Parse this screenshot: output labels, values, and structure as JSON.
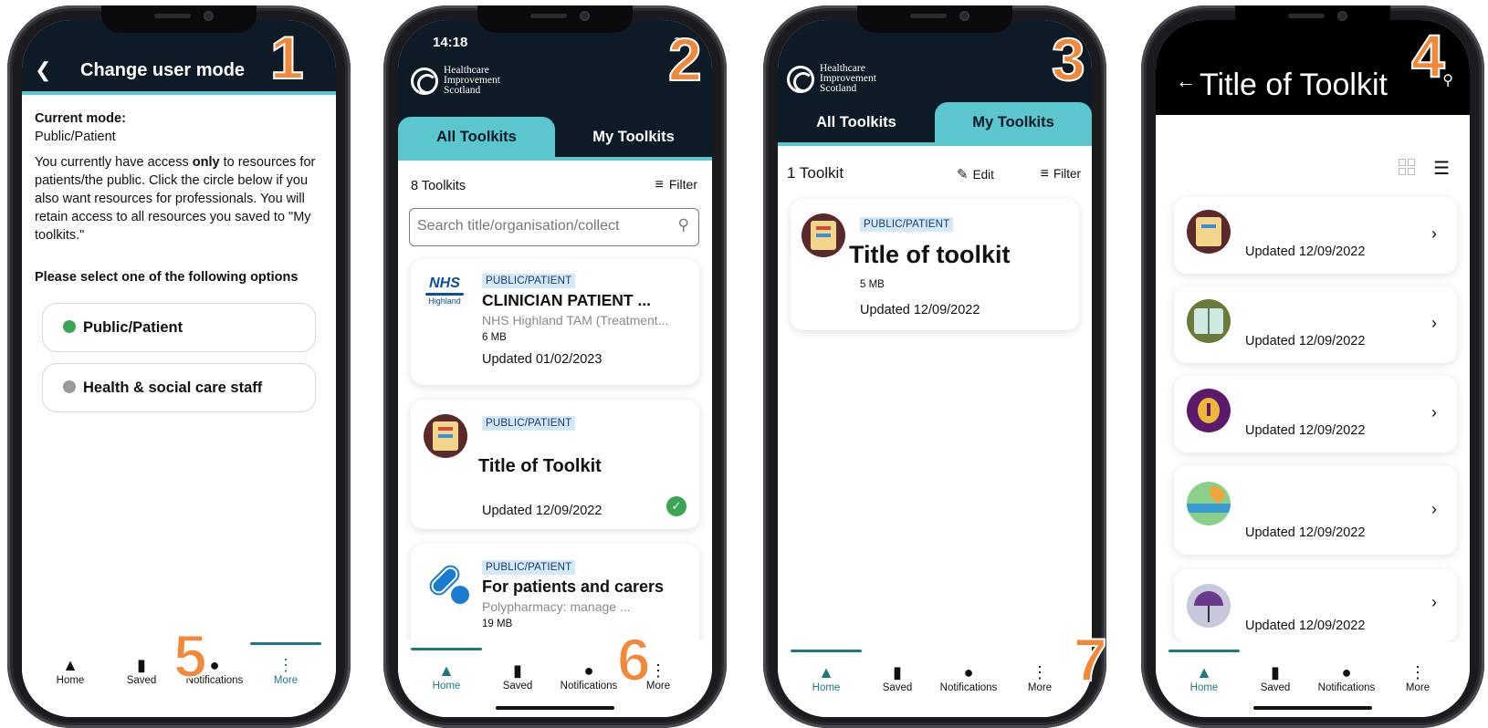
{
  "numbers": [
    "1",
    "2",
    "3",
    "4",
    "5",
    "6",
    "7"
  ],
  "nav": {
    "home": "Home",
    "saved": "Saved",
    "notifications": "Notifications",
    "more": "More"
  },
  "logo": {
    "line1": "Healthcare",
    "line2": "Improvement",
    "line3": "Scotland"
  },
  "tabs": {
    "all": "All Toolkits",
    "mine": "My Toolkits"
  },
  "screen1": {
    "title": "Change user mode",
    "current_label": "Current mode:",
    "current_value": "Public/Patient",
    "desc_a": "You currently have access ",
    "desc_b": "only",
    "desc_c": " to resources for patients/the public. Click the circle below if you also want resources for professionals. You will retain access to all resources you saved to \"My toolkits.\"",
    "prompt": "Please select one of the following options",
    "option1": "Public/Patient",
    "option2": "Health & social care staff"
  },
  "screen2": {
    "time": "14:18",
    "count": "8 Toolkits",
    "filter": "Filter",
    "search_placeholder": "Search title/organisation/collect",
    "cards": [
      {
        "badge": "PUBLIC/PATIENT",
        "title": "CLINICIAN PATIENT ...",
        "org": "NHS Highland TAM (Treatment...",
        "size": "6 MB",
        "updated": "Updated 01/02/2023",
        "logo_a": "NHS",
        "logo_b": "Highland"
      },
      {
        "badge": "PUBLIC/PATIENT",
        "title": "Title of Toolkit",
        "updated": "Updated 12/09/2022"
      },
      {
        "badge": "PUBLIC/PATIENT",
        "title": "For patients and carers",
        "org": "Polypharmacy: manage ...",
        "size": "19 MB"
      }
    ]
  },
  "screen3": {
    "count": "1 Toolkit",
    "edit": "Edit",
    "filter": "Filter",
    "card": {
      "badge": "PUBLIC/PATIENT",
      "title": "Title of toolkit",
      "size": "5 MB",
      "updated": "Updated 12/09/2022"
    }
  },
  "screen4": {
    "title": "Title of Toolkit",
    "items": [
      {
        "updated": "Updated 12/09/2022"
      },
      {
        "updated": "Updated 12/09/2022"
      },
      {
        "updated": "Updated 12/09/2022"
      },
      {
        "updated": "Updated 12/09/2022"
      },
      {
        "updated": "Updated 12/09/2022"
      }
    ]
  }
}
